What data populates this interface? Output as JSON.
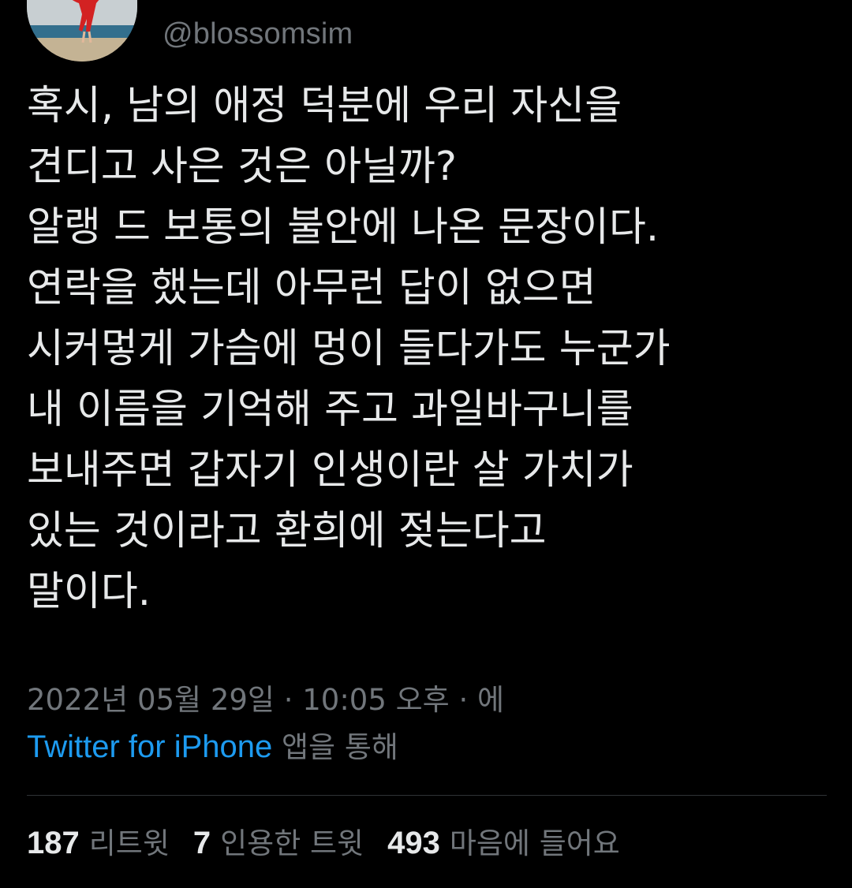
{
  "tweet": {
    "handle": "@blossomsim",
    "text_lines": [
      "혹시, 남의 애정 덕분에 우리 자신을",
      "견디고 사은 것은 아닐까?",
      "알랭 드 보통의 불안에 나온 문장이다.",
      "연락을 했는데 아무런 답이 없으면",
      "시커멓게 가슴에 멍이 들다가도 누군가",
      "내 이름을 기억해 주고 과일바구니를",
      "보내주면 갑자기 인생이란 살 가치가",
      "있는 것이라고 환희에 젖는다고",
      "말이다."
    ],
    "timestamp": "2022년 05월 29일 · 10:05 오후 · 에",
    "source_app": "Twitter for iPhone",
    "source_suffix": "앱을 통해"
  },
  "stats": {
    "retweets": {
      "count": "187",
      "label": "리트윗"
    },
    "quotes": {
      "count": "7",
      "label": "인용한 트윗"
    },
    "likes": {
      "count": "493",
      "label": "마음에 들어요"
    }
  },
  "colors": {
    "background": "#000000",
    "text": "#e7e9ea",
    "secondary": "#71767b",
    "link": "#1d9bf0",
    "divider": "#2f3336"
  }
}
